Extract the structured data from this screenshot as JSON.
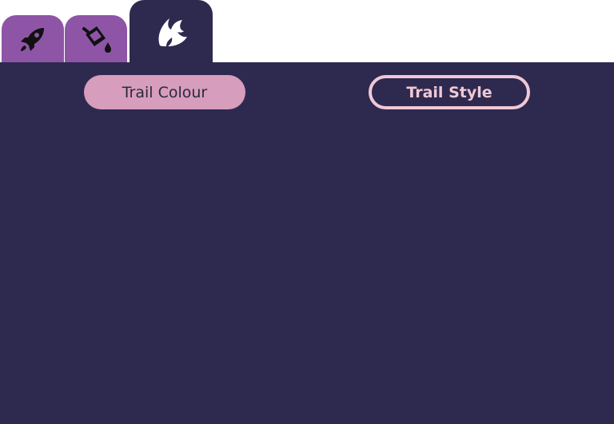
{
  "theme": {
    "panel_bg": "#2e2a4f",
    "tab_inactive": "#8e55a7",
    "accent": "#d79dbd",
    "accent_outline": "#f0c8d6",
    "icon_dark": "#111111",
    "icon_light": "#ffffff"
  },
  "tabs": [
    {
      "id": "ship",
      "icon": "rocket-icon",
      "active": false
    },
    {
      "id": "paint",
      "icon": "paint-bucket-icon",
      "active": false
    },
    {
      "id": "trail",
      "icon": "trail-flame-icon",
      "active": true
    }
  ],
  "buttons": {
    "trail_colour": {
      "label": "Trail Colour"
    },
    "trail_style": {
      "label": "Trail Style"
    }
  }
}
